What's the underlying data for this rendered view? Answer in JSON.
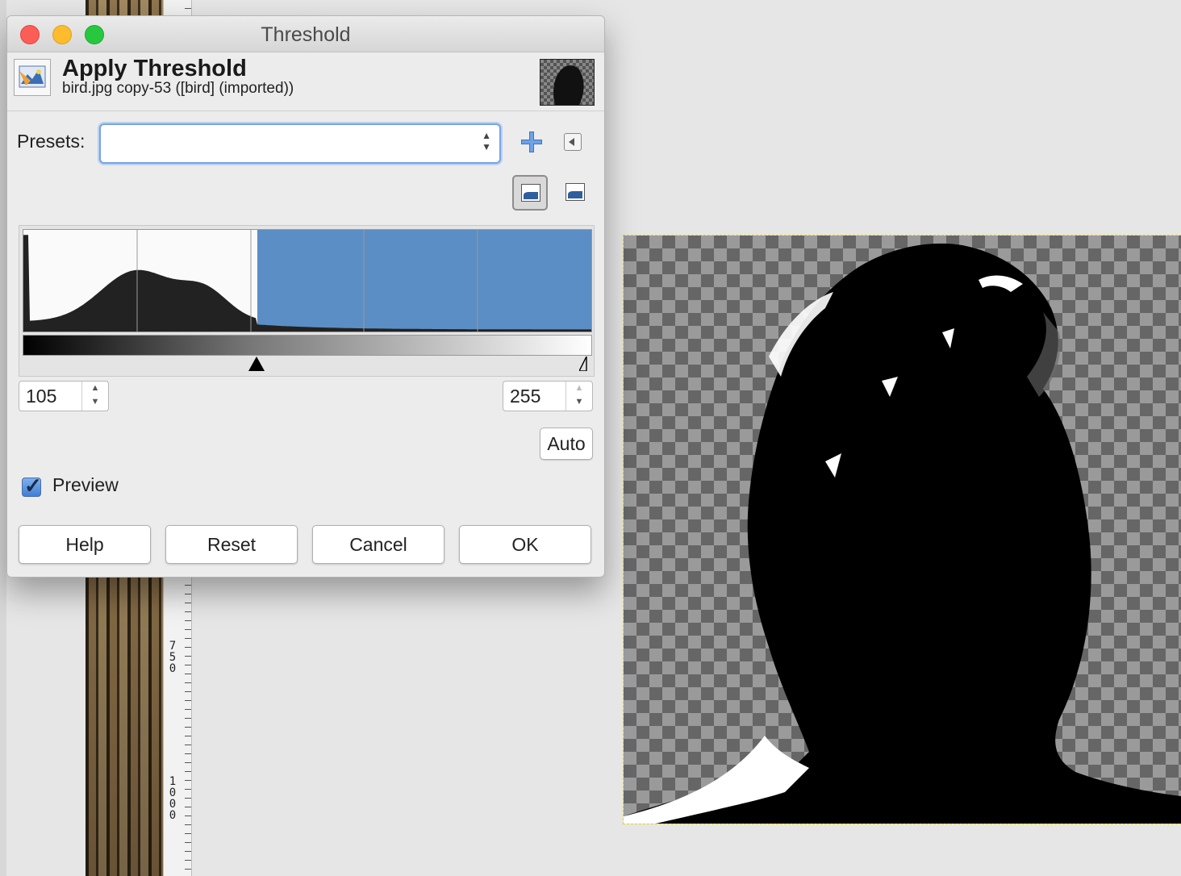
{
  "window": {
    "title": "Threshold"
  },
  "header": {
    "title": "Apply Threshold",
    "subtitle": "bird.jpg copy-53 ([bird] (imported))",
    "icon": "threshold-tool-icon"
  },
  "presets": {
    "label": "Presets:",
    "value": "",
    "add_icon": "plus-icon",
    "menu_icon": "triangle-left-icon"
  },
  "histogram": {
    "scale_options": [
      "linear",
      "logarithmic"
    ],
    "selected_scale": "linear",
    "threshold_low": 105,
    "threshold_high": 255,
    "range_max": 255,
    "highlight_color": "#5b8ec4"
  },
  "spinners": {
    "low": "105",
    "high": "255"
  },
  "buttons": {
    "auto": "Auto",
    "help": "Help",
    "reset": "Reset",
    "cancel": "Cancel",
    "ok": "OK"
  },
  "preview": {
    "label": "Preview",
    "checked": true
  },
  "ruler": {
    "labels": [
      "750",
      "1000"
    ]
  }
}
